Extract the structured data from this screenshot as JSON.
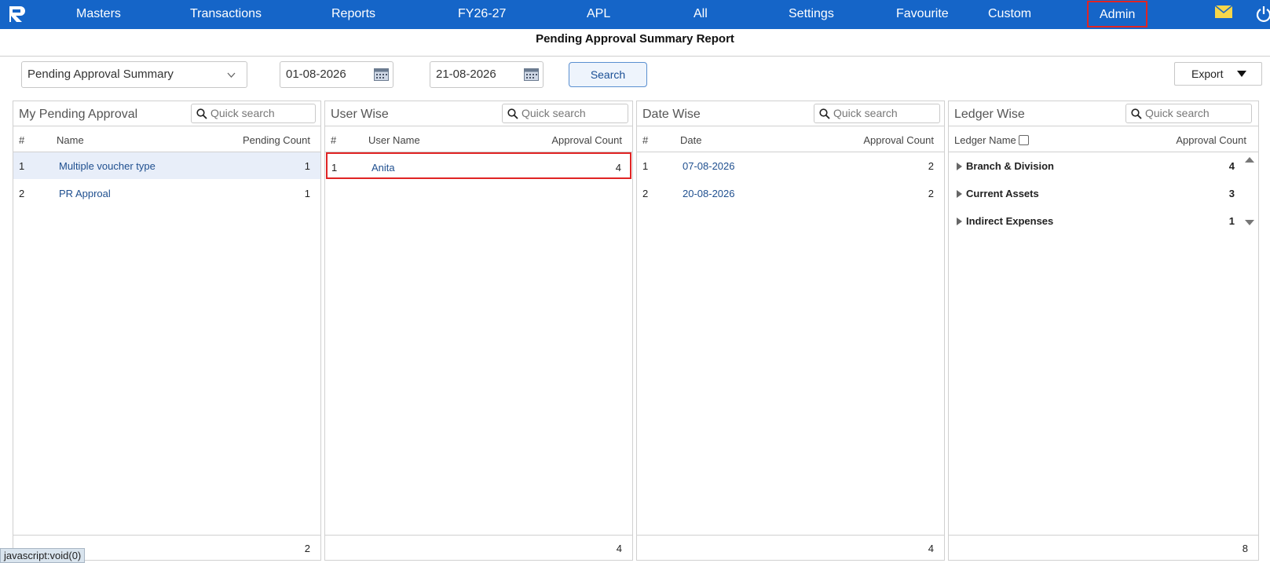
{
  "nav": {
    "items": [
      "Masters",
      "Transactions",
      "Reports",
      "FY26-27",
      "APL",
      "All",
      "Settings",
      "Favourite",
      "Custom",
      "Admin"
    ],
    "icons": [
      "mail-icon",
      "power-icon"
    ],
    "brand_color": "#1565c8",
    "highlight_color": "#e02424"
  },
  "page": {
    "title": "Pending Approval Summary Report"
  },
  "filters": {
    "report_type": "Pending Approval Summary",
    "from_date": "01-08-2026",
    "to_date": "21-08-2026",
    "search_label": "Search",
    "export_label": "Export"
  },
  "panels": {
    "my_pending": {
      "title": "My Pending Approval",
      "search_placeholder": "Quick search",
      "columns": [
        "#",
        "Name",
        "Pending Count"
      ],
      "rows": [
        {
          "num": "1",
          "name": "Multiple voucher type",
          "count": "1"
        },
        {
          "num": "2",
          "name": "PR Approal",
          "count": "1"
        }
      ],
      "total": "2"
    },
    "user_wise": {
      "title": "User Wise",
      "search_placeholder": "Quick search",
      "columns": [
        "#",
        "User Name",
        "Approval Count"
      ],
      "rows": [
        {
          "num": "1",
          "name": "Anita",
          "count": "4"
        }
      ],
      "total": "4"
    },
    "date_wise": {
      "title": "Date Wise",
      "search_placeholder": "Quick search",
      "columns": [
        "#",
        "Date",
        "Approval Count"
      ],
      "rows": [
        {
          "num": "1",
          "date": "07-08-2026",
          "count": "2"
        },
        {
          "num": "2",
          "date": "20-08-2026",
          "count": "2"
        }
      ],
      "total": "4"
    },
    "ledger_wise": {
      "title": "Ledger Wise",
      "search_placeholder": "Quick search",
      "columns": [
        "Ledger Name",
        "Approval Count"
      ],
      "rows": [
        {
          "name": "Branch & Division",
          "count": "4"
        },
        {
          "name": "Current Assets",
          "count": "3"
        },
        {
          "name": "Indirect Expenses",
          "count": "1"
        }
      ],
      "total": "8"
    }
  },
  "status_bar": "javascript:void(0)"
}
